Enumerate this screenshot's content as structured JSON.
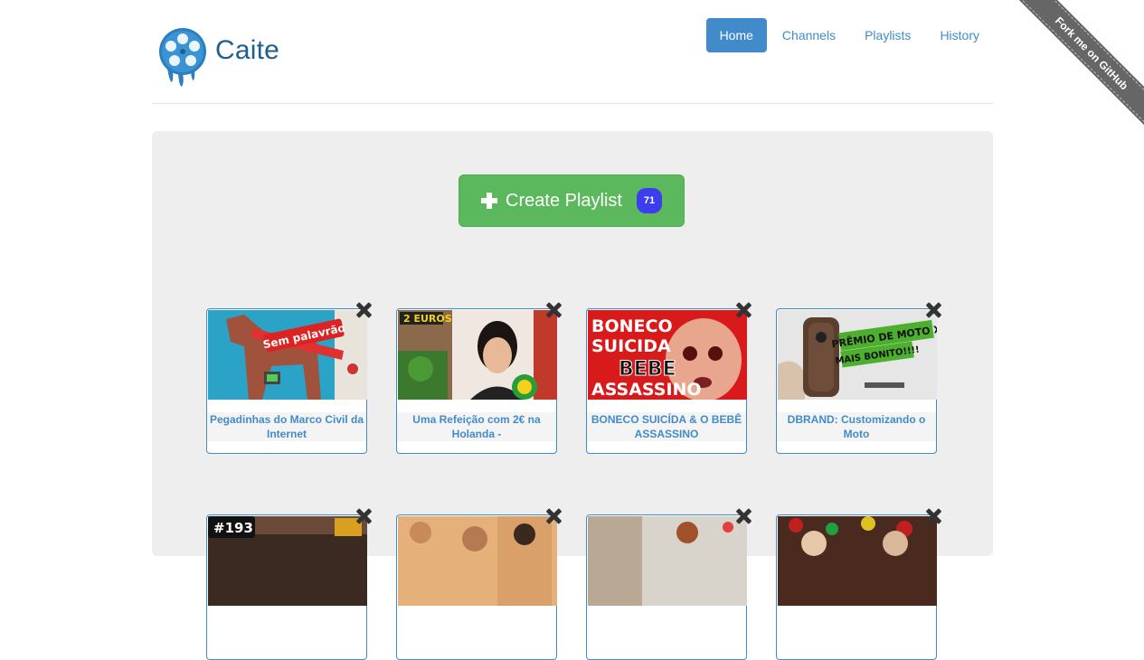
{
  "brand": {
    "name": "Caite"
  },
  "nav": {
    "items": [
      "Home",
      "Channels",
      "Playlists",
      "History"
    ],
    "active": "Home"
  },
  "ribbon": {
    "label": "Fork me on GitHub"
  },
  "create": {
    "label": "Create Playlist",
    "count": "71"
  },
  "thumbnails": {
    "t1": "Sem palavrão",
    "t2": "2 EUROS",
    "t3a": "BONECO",
    "t3b": "SUICIDA",
    "t3c": "BEBE",
    "t3d": "ASSASSINO",
    "t4a": "PRÊMIO DE MOTO X",
    "t4b": "MAIS BONITO!!!!",
    "t5": "#193"
  },
  "videos": [
    {
      "title": "Pegadinhas do Marco Civil da Internet"
    },
    {
      "title": "Uma Refeição com 2€ na Holanda -"
    },
    {
      "title": "BONECO SUICÍDA & O BEBÊ ASSASSINO"
    },
    {
      "title": "DBRAND: Customizando o Moto"
    }
  ],
  "colors": {
    "primary": "#428bca",
    "success": "#5cb85c",
    "badge": "#3d3df0",
    "jumbotron": "#eeeeee"
  }
}
